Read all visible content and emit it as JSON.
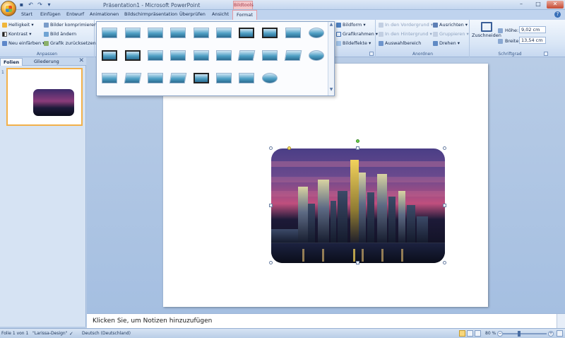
{
  "window": {
    "title": "Präsentation1 - Microsoft PowerPoint",
    "context_tab": "Bildtools",
    "qat_icons": [
      "save-icon",
      "undo-icon",
      "redo-icon",
      "customize-icon"
    ]
  },
  "tabs": [
    "Start",
    "Einfügen",
    "Entwurf",
    "Animationen",
    "Bildschirmpräsentation",
    "Überprüfen",
    "Ansicht",
    "Format"
  ],
  "active_tab": "Format",
  "ribbon": {
    "anpassen": {
      "label": "Anpassen",
      "helligkeit": "Helligkeit",
      "kontrast": "Kontrast",
      "neu_einfaerben": "Neu einfärben",
      "bilder_komprimieren": "Bilder komprimieren",
      "bild_aendern": "Bild ändern",
      "grafik_zuruecksetzen": "Grafik zurücksetzen"
    },
    "bildformatvorlagen": {
      "bildform": "Bildform",
      "grafikrahmen": "Grafikrahmen",
      "bildeffekte": "Bildeffekte"
    },
    "anordnen": {
      "label": "Anordnen",
      "in_den_vordergrund": "In den Vordergrund",
      "in_den_hintergrund": "In den Hintergrund",
      "auswahlbereich": "Auswahlbereich",
      "ausrichten": "Ausrichten",
      "gruppieren": "Gruppieren",
      "drehen": "Drehen"
    },
    "schriftgrad": {
      "label": "Schriftgrad",
      "zuschneiden": "Zuschneiden",
      "hoehe_label": "Höhe:",
      "hoehe_value": "9,02 cm",
      "breite_label": "Breite:",
      "breite_value": "13,54 cm"
    }
  },
  "left_pane": {
    "tabs": [
      "Folien",
      "Gliederung"
    ],
    "close": "✕",
    "slide_number": "1"
  },
  "notes": {
    "placeholder": "Klicken Sie, um Notizen hinzuzufügen"
  },
  "status_bar": {
    "slide_info": "Folie 1 von 1",
    "design": "\"Larissa-Design\"",
    "language": "Deutsch (Deutschland)",
    "zoom": "80 %"
  }
}
